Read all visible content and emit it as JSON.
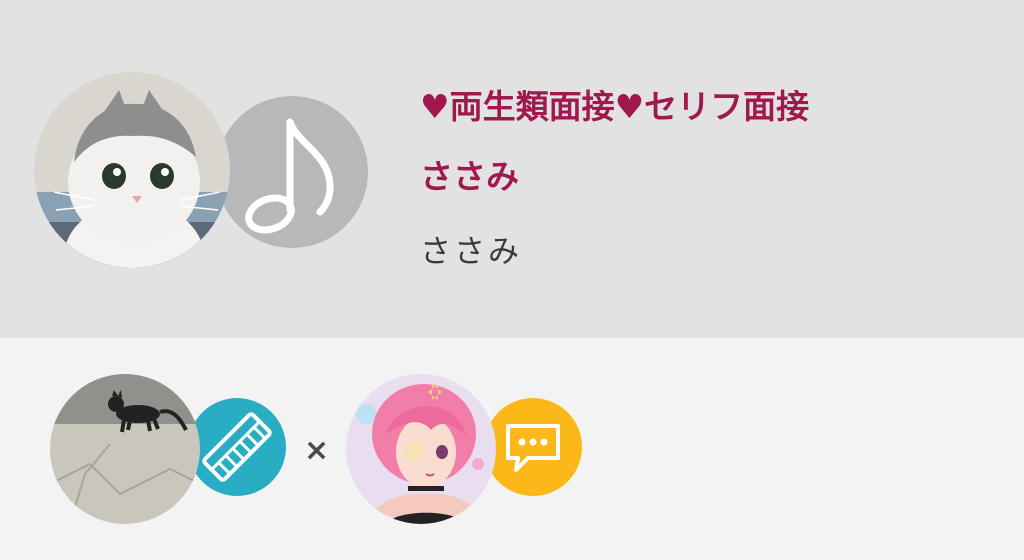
{
  "recording": {
    "title": "♥両生類面接♥セリフ面接",
    "artist": "ささみ",
    "uploader": "ささみ",
    "title_color": "#a0184e",
    "header_bg": "#e2e2e2",
    "footer_bg": "#f3f3f3"
  },
  "main_avatar": {
    "icon": "cat-photo-avatar"
  },
  "main_badge": {
    "icon": "music-note-icon",
    "color": "#b8b8b8"
  },
  "collab": {
    "separator": "×",
    "left": {
      "icon": "cat-on-pavement-avatar",
      "badge_icon": "keyboard-icon",
      "badge_color": "#28adc2"
    },
    "right": {
      "icon": "anime-girl-avatar",
      "badge_icon": "speech-bubble-icon",
      "badge_color": "#fbb818"
    }
  }
}
